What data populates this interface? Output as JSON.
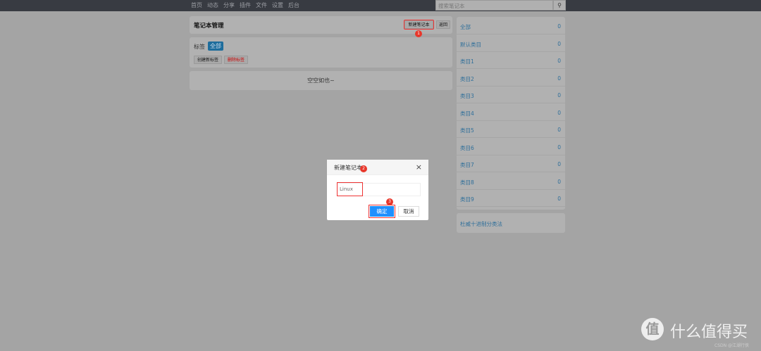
{
  "nav": {
    "items": [
      "首页",
      "动态",
      "分享",
      "插件",
      "文件",
      "设置",
      "后台"
    ],
    "search_placeholder": "搜索笔记本",
    "search_icon": "search-icon"
  },
  "header": {
    "title": "笔记本管理",
    "new_notebook": "新建笔记本",
    "back": "返回",
    "badge1": "1"
  },
  "tags": {
    "label": "标签",
    "all": "全部",
    "create": "创建新标签",
    "delete": "删除标签"
  },
  "empty": "空空如也~",
  "sidebar": {
    "items": [
      {
        "label": "全部",
        "count": "0"
      },
      {
        "label": "默认类目",
        "count": "0"
      },
      {
        "label": "类目1",
        "count": "0"
      },
      {
        "label": "类目2",
        "count": "0"
      },
      {
        "label": "类目3",
        "count": "0"
      },
      {
        "label": "类目4",
        "count": "0"
      },
      {
        "label": "类目5",
        "count": "0"
      },
      {
        "label": "类目6",
        "count": "0"
      },
      {
        "label": "类目7",
        "count": "0"
      },
      {
        "label": "类目8",
        "count": "0"
      },
      {
        "label": "类目9",
        "count": "0"
      }
    ],
    "dewey": "杜威十进制分类法"
  },
  "modal": {
    "title": "新建笔记本",
    "close": "×",
    "input_value": "Linux",
    "ok": "确定",
    "cancel": "取消",
    "badge2": "2",
    "badge3": "3"
  },
  "watermark": {
    "brand": "什么值得买",
    "logo": "值",
    "sub": "CSDN @江湖行侠"
  }
}
